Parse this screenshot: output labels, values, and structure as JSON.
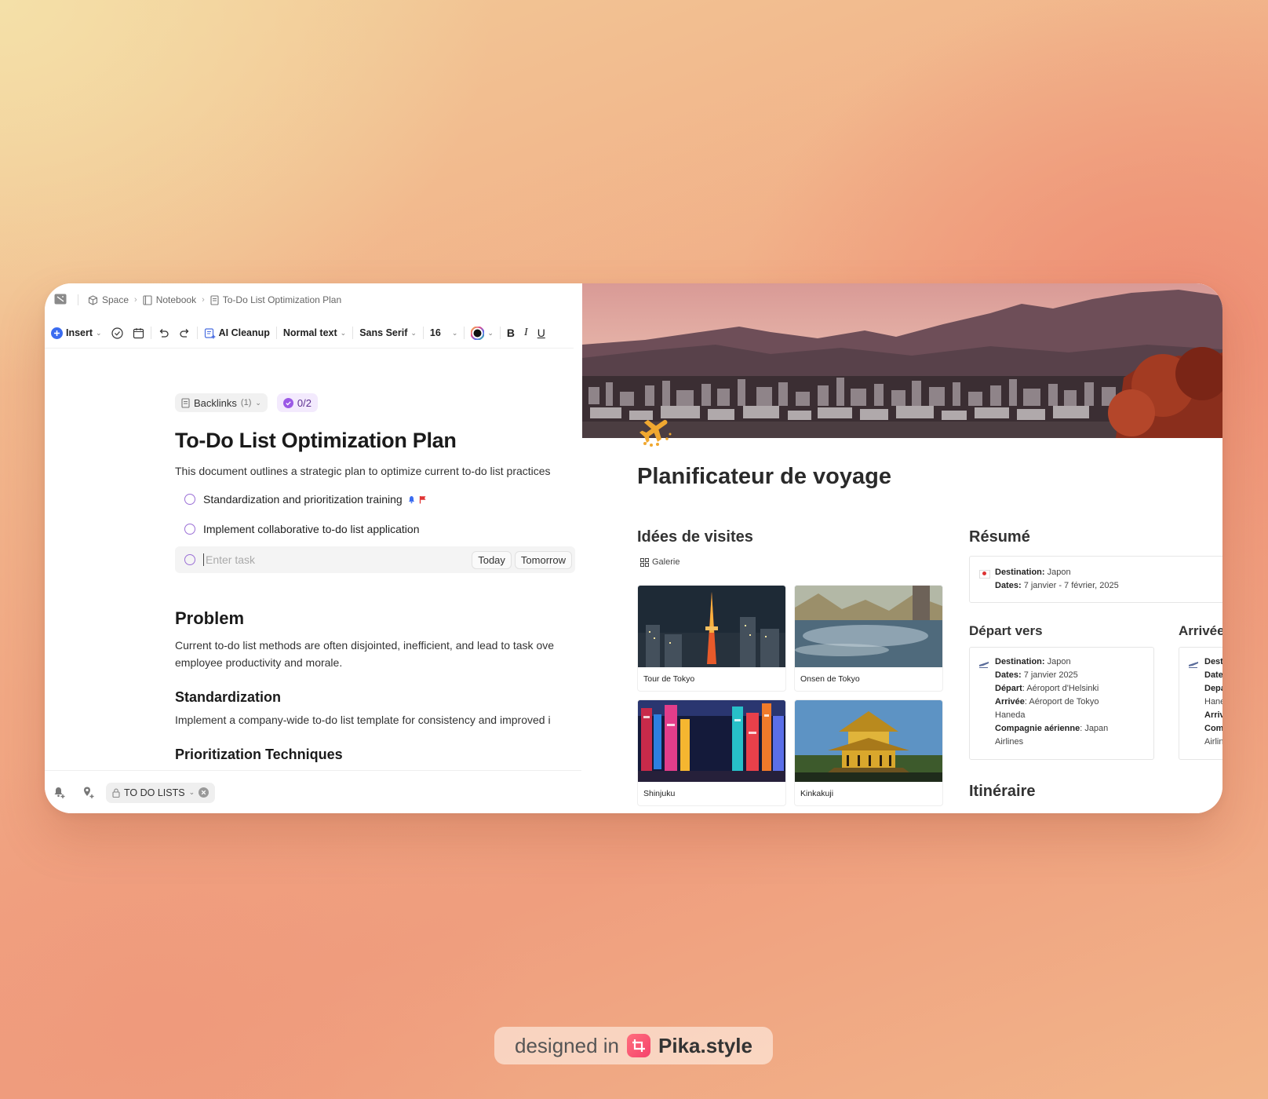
{
  "editor": {
    "breadcrumb": [
      "Space",
      "Notebook",
      "To-Do List Optimization Plan"
    ],
    "toolbar": {
      "insert": "Insert",
      "ai_cleanup": "AI Cleanup",
      "text_style": "Normal text",
      "font": "Sans Serif",
      "font_size": "16",
      "bold": "B",
      "italic": "I",
      "underline": "U"
    },
    "backlinks": {
      "label": "Backlinks",
      "count": "(1)"
    },
    "progress": "0/2",
    "title": "To-Do List Optimization Plan",
    "intro": "This document outlines a strategic plan to optimize current to-do list practices",
    "tasks": [
      "Standardization and prioritization training",
      "Implement collaborative to-do list application"
    ],
    "task_entry": {
      "placeholder": "Enter task",
      "today": "Today",
      "tomorrow": "Tomorrow"
    },
    "problem_heading": "Problem",
    "problem_text": [
      "Current to-do list methods are often disjointed, inefficient, and lead to task ove",
      "employee productivity and morale."
    ],
    "standardization_heading": "Standardization",
    "standardization_text": "Implement a company-wide to-do list template for consistency and improved i",
    "prioritization_heading": "Prioritization Techniques",
    "bottom_tag": "TO DO LISTS"
  },
  "travel": {
    "title": "Planificateur de voyage",
    "ideas_heading": "Idées de visites",
    "gallery_label": "Galerie",
    "gallery": [
      "Tour de Tokyo",
      "Onsen de Tokyo",
      "Shinjuku",
      "Kinkakuji"
    ],
    "resume_heading": "Résumé",
    "resume": {
      "destination_label": "Destination:",
      "destination": "Japon",
      "dates_label": "Dates:",
      "dates": "7 janvier - 7 février, 2025"
    },
    "depart_heading": "Départ vers",
    "depart": {
      "destination_label": "Destination:",
      "destination": "Japon",
      "dates_label": "Dates:",
      "dates": "7 janvier 2025",
      "depart_label": "Départ",
      "depart": ": Aéroport d'Helsinki",
      "arrivee_label": "Arrivée",
      "arrivee": ": Aéroport de Tokyo",
      "arrivee_line2": "Haneda",
      "airline_label": "Compagnie aérienne",
      "airline": ": Japan",
      "airline_line2": "Airlines"
    },
    "arrivee_heading": "Arrivée",
    "arrivee_partial": [
      "Desti",
      "Date",
      "Depa",
      "Hane",
      "Arriv",
      "Com",
      "Airlin"
    ],
    "itinerary_heading": "Itinéraire"
  },
  "watermark": {
    "prefix": "designed in",
    "brand": "Pika.style"
  },
  "colors": {
    "accent": "#9b6fd6",
    "insert_blue": "#3b6cf0"
  }
}
